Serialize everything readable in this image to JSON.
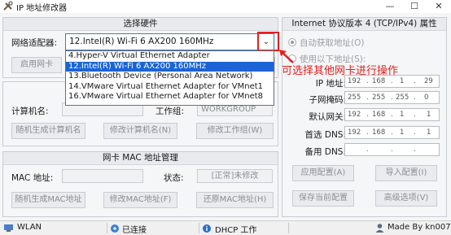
{
  "window": {
    "title": "IP 地址修改器",
    "min": "—",
    "max": "☐",
    "close": "✕"
  },
  "hardware": {
    "title": "选择硬件",
    "adapter_label": "网络适配器:",
    "adapter_value": "12.Intel(R) Wi-Fi 6 AX200 160MHz",
    "options": [
      "4.Hyper-V Virtual Ethernet Adapter",
      "12.Intel(R) Wi-Fi 6 AX200 160MHz",
      "13.Bluetooth Device (Personal Area Network)",
      "14.VMware Virtual Ethernet Adapter for VMnet1",
      "16.VMware Virtual Ethernet Adapter for VMnet8"
    ],
    "selected_index": 1,
    "enable_button": "启用网卡",
    "disable_button": "卡"
  },
  "computer": {
    "name_label": "计算机名:",
    "workgroup_label": "工作组:",
    "workgroup_value": "WORKGROUP",
    "random_name_button": "随机生成计算机名",
    "modify_name_button": "修改计算机名(N)",
    "modify_workgroup_button": "修改工作组(W)"
  },
  "mac": {
    "title": "网卡 MAC 地址管理",
    "mac_label": "MAC 地址:",
    "status_label": "状态:",
    "status_value": "[正常]未修改",
    "random_mac_button": "随机生成MAC地址",
    "modify_mac_button": "修改MAC地址(F)",
    "restore_mac_button": "还原MAC地址(H)"
  },
  "ipv4": {
    "title": "Internet 协议版本 4 (TCP/IPv4) 属性",
    "auto_label": "自动获取地址(O)",
    "manual_label": "使用以下地址(S):",
    "ip_label": "IP 地址:",
    "ip": [
      "192",
      "168",
      "1",
      "29"
    ],
    "mask_label": "子网掩码:",
    "mask": [
      "255",
      "255",
      "255",
      "0"
    ],
    "gateway_label": "默认网关:",
    "gateway": [
      "192",
      "168",
      "1",
      "1"
    ],
    "dns1_label": "首选 DNS:",
    "dns1": [
      "192",
      "168",
      "1",
      "1"
    ],
    "dns2_label": "备用 DNS:",
    "apply_button": "应用配置(A)",
    "import_button": "导入配置(I)",
    "save_button": "保存当前配置",
    "advanced_button": "高级选项(V)"
  },
  "annotation": {
    "text": "可选择其他网卡进行操作",
    "color": "#e32020"
  },
  "statusbar": {
    "wlan": "WLAN",
    "connected": "已连接",
    "dhcp": "DHCP 工作",
    "made_by": "Made By kn007"
  }
}
